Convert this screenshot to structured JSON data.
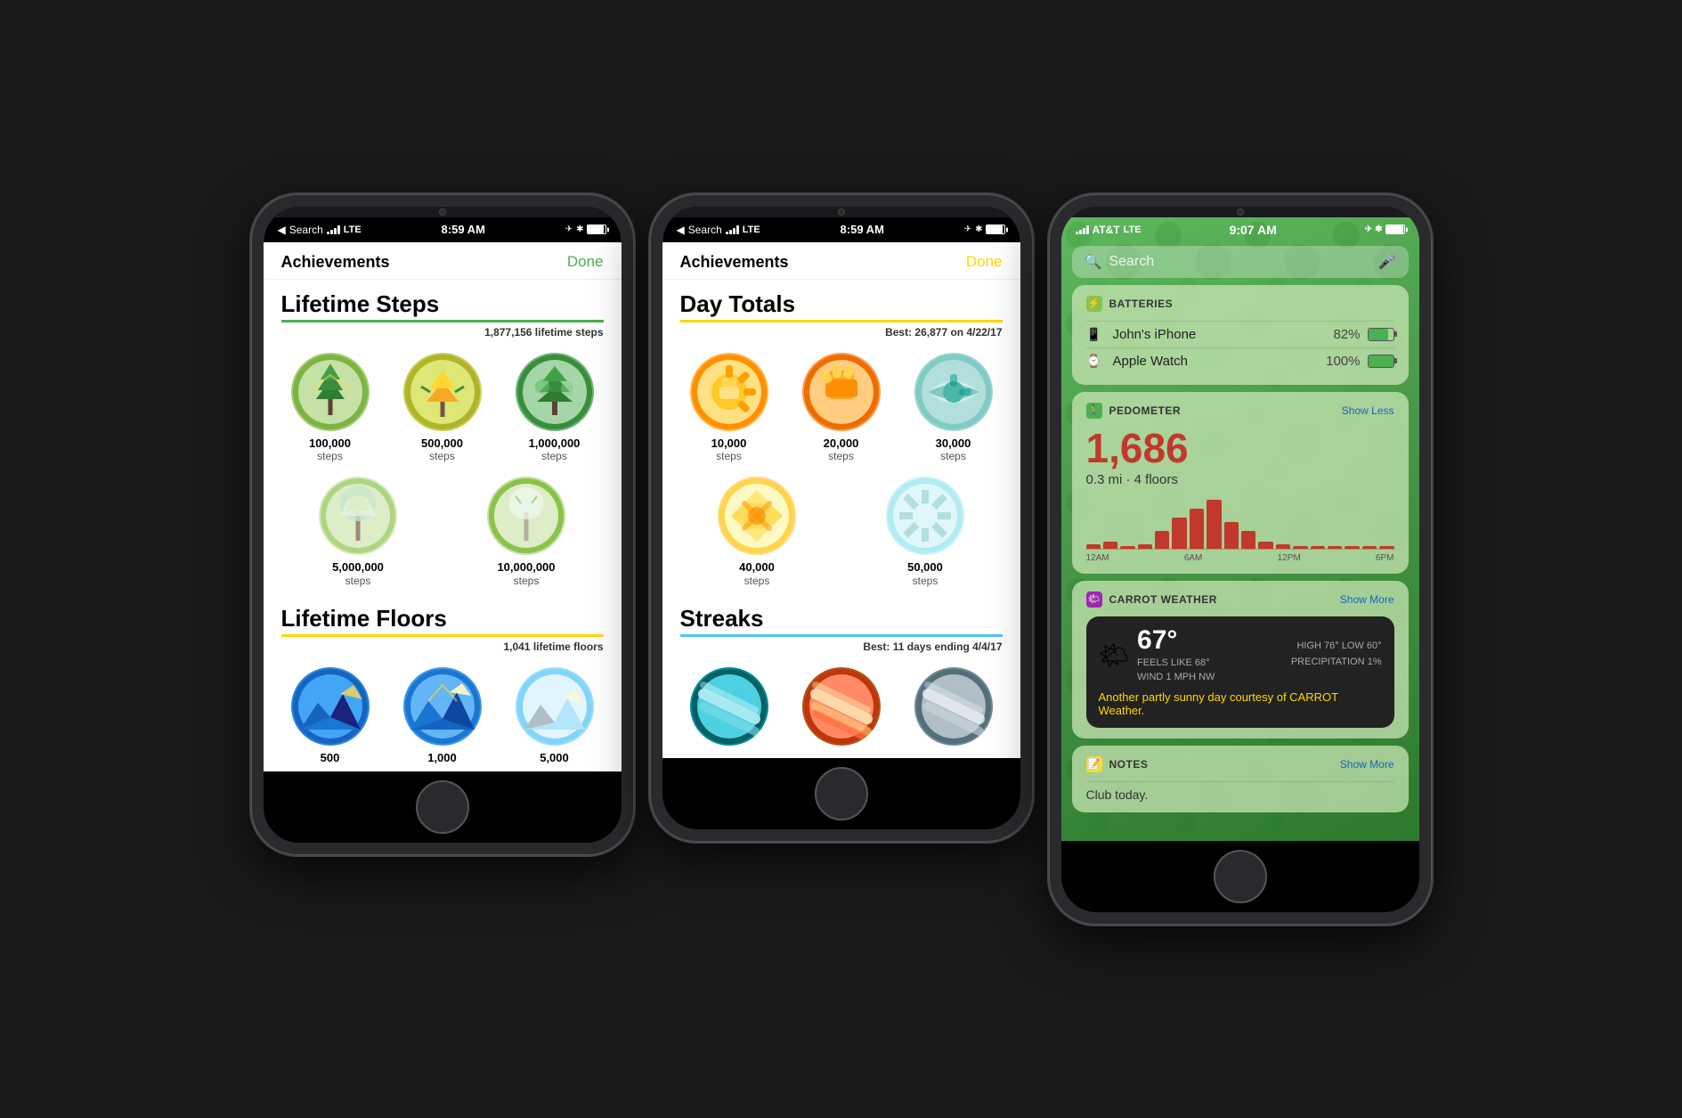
{
  "phone1": {
    "statusBar": {
      "left": "Search",
      "signal": "LTE",
      "time": "8:59 AM",
      "battery": 90
    },
    "header": {
      "title": "Achievements",
      "done": "Done",
      "doneColor": "green"
    },
    "sections": [
      {
        "name": "Lifetime Steps",
        "color": "green",
        "subtitle": "1,877,156 lifetime steps",
        "badges": [
          {
            "label": "100,000",
            "sub": "steps",
            "type": "tree1"
          },
          {
            "label": "500,000",
            "sub": "steps",
            "type": "tree2"
          },
          {
            "label": "1,000,000",
            "sub": "steps",
            "type": "tree3"
          },
          {
            "label": "5,000,000",
            "sub": "steps",
            "type": "tree4"
          },
          {
            "label": "10,000,000",
            "sub": "steps",
            "type": "tree5"
          }
        ]
      },
      {
        "name": "Lifetime Floors",
        "color": "yellow",
        "subtitle": "1,041 lifetime floors",
        "badges": [
          {
            "label": "500",
            "sub": "",
            "type": "mtn1"
          },
          {
            "label": "1,000",
            "sub": "",
            "type": "mtn2"
          },
          {
            "label": "5,000",
            "sub": "",
            "type": "mtn3"
          }
        ]
      }
    ]
  },
  "phone2": {
    "statusBar": {
      "left": "Search",
      "signal": "LTE",
      "time": "8:59 AM",
      "battery": 90
    },
    "header": {
      "title": "Achievements",
      "done": "Done",
      "doneColor": "yellow"
    },
    "sections": [
      {
        "name": "Day Totals",
        "color": "yellow",
        "subtitle": "Best: 26,877 on 4/22/17",
        "badges": [
          {
            "label": "10,000",
            "sub": "steps",
            "type": "sun1"
          },
          {
            "label": "20,000",
            "sub": "steps",
            "type": "sun2"
          },
          {
            "label": "30,000",
            "sub": "steps",
            "type": "sun3"
          },
          {
            "label": "40,000",
            "sub": "steps",
            "type": "sun4"
          },
          {
            "label": "50,000",
            "sub": "steps",
            "type": "sun5"
          }
        ]
      },
      {
        "name": "Streaks",
        "color": "blue",
        "subtitle": "Best: 11 days ending 4/4/17",
        "badges": [
          {
            "label": "",
            "sub": "",
            "type": "streak1"
          },
          {
            "label": "",
            "sub": "",
            "type": "streak2"
          },
          {
            "label": "",
            "sub": "",
            "type": "streak3"
          }
        ]
      }
    ]
  },
  "phone3": {
    "statusBar": {
      "carrier": "AT&T",
      "signal": "LTE",
      "time": "9:07 AM",
      "battery": 95
    },
    "search": {
      "placeholder": "Search"
    },
    "batteries": {
      "title": "BATTERIES",
      "devices": [
        {
          "name": "John's iPhone",
          "pct": "82%",
          "fill": 82,
          "icon": "📱"
        },
        {
          "name": "Apple Watch",
          "pct": "100%",
          "fill": 100,
          "icon": "⌚"
        }
      ]
    },
    "pedometer": {
      "title": "PEDOMETER",
      "action": "Show Less",
      "steps": "1,686",
      "details": "0.3 mi · 4 floors",
      "chartBars": [
        2,
        3,
        1,
        2,
        8,
        14,
        18,
        22,
        12,
        8,
        3,
        2,
        1,
        1,
        1,
        1,
        1,
        1
      ],
      "chartLabels": [
        "12AM",
        "6AM",
        "12PM",
        "6PM"
      ]
    },
    "carrotWeather": {
      "title": "CARROT WEATHER",
      "action": "Show More",
      "temp": "67°",
      "feelsLike": "FEELS LIKE 68°",
      "wind": "WIND 1 MPH NW",
      "high": "HIGH 76°",
      "low": "LOW 60°",
      "precip": "PRECIPITATION 1%",
      "description": "Another",
      "highlight": "partly sunny day",
      "suffix": "courtesy of CARROT Weather."
    },
    "notes": {
      "title": "NOTES",
      "action": "Show More",
      "content": "Club today."
    }
  }
}
